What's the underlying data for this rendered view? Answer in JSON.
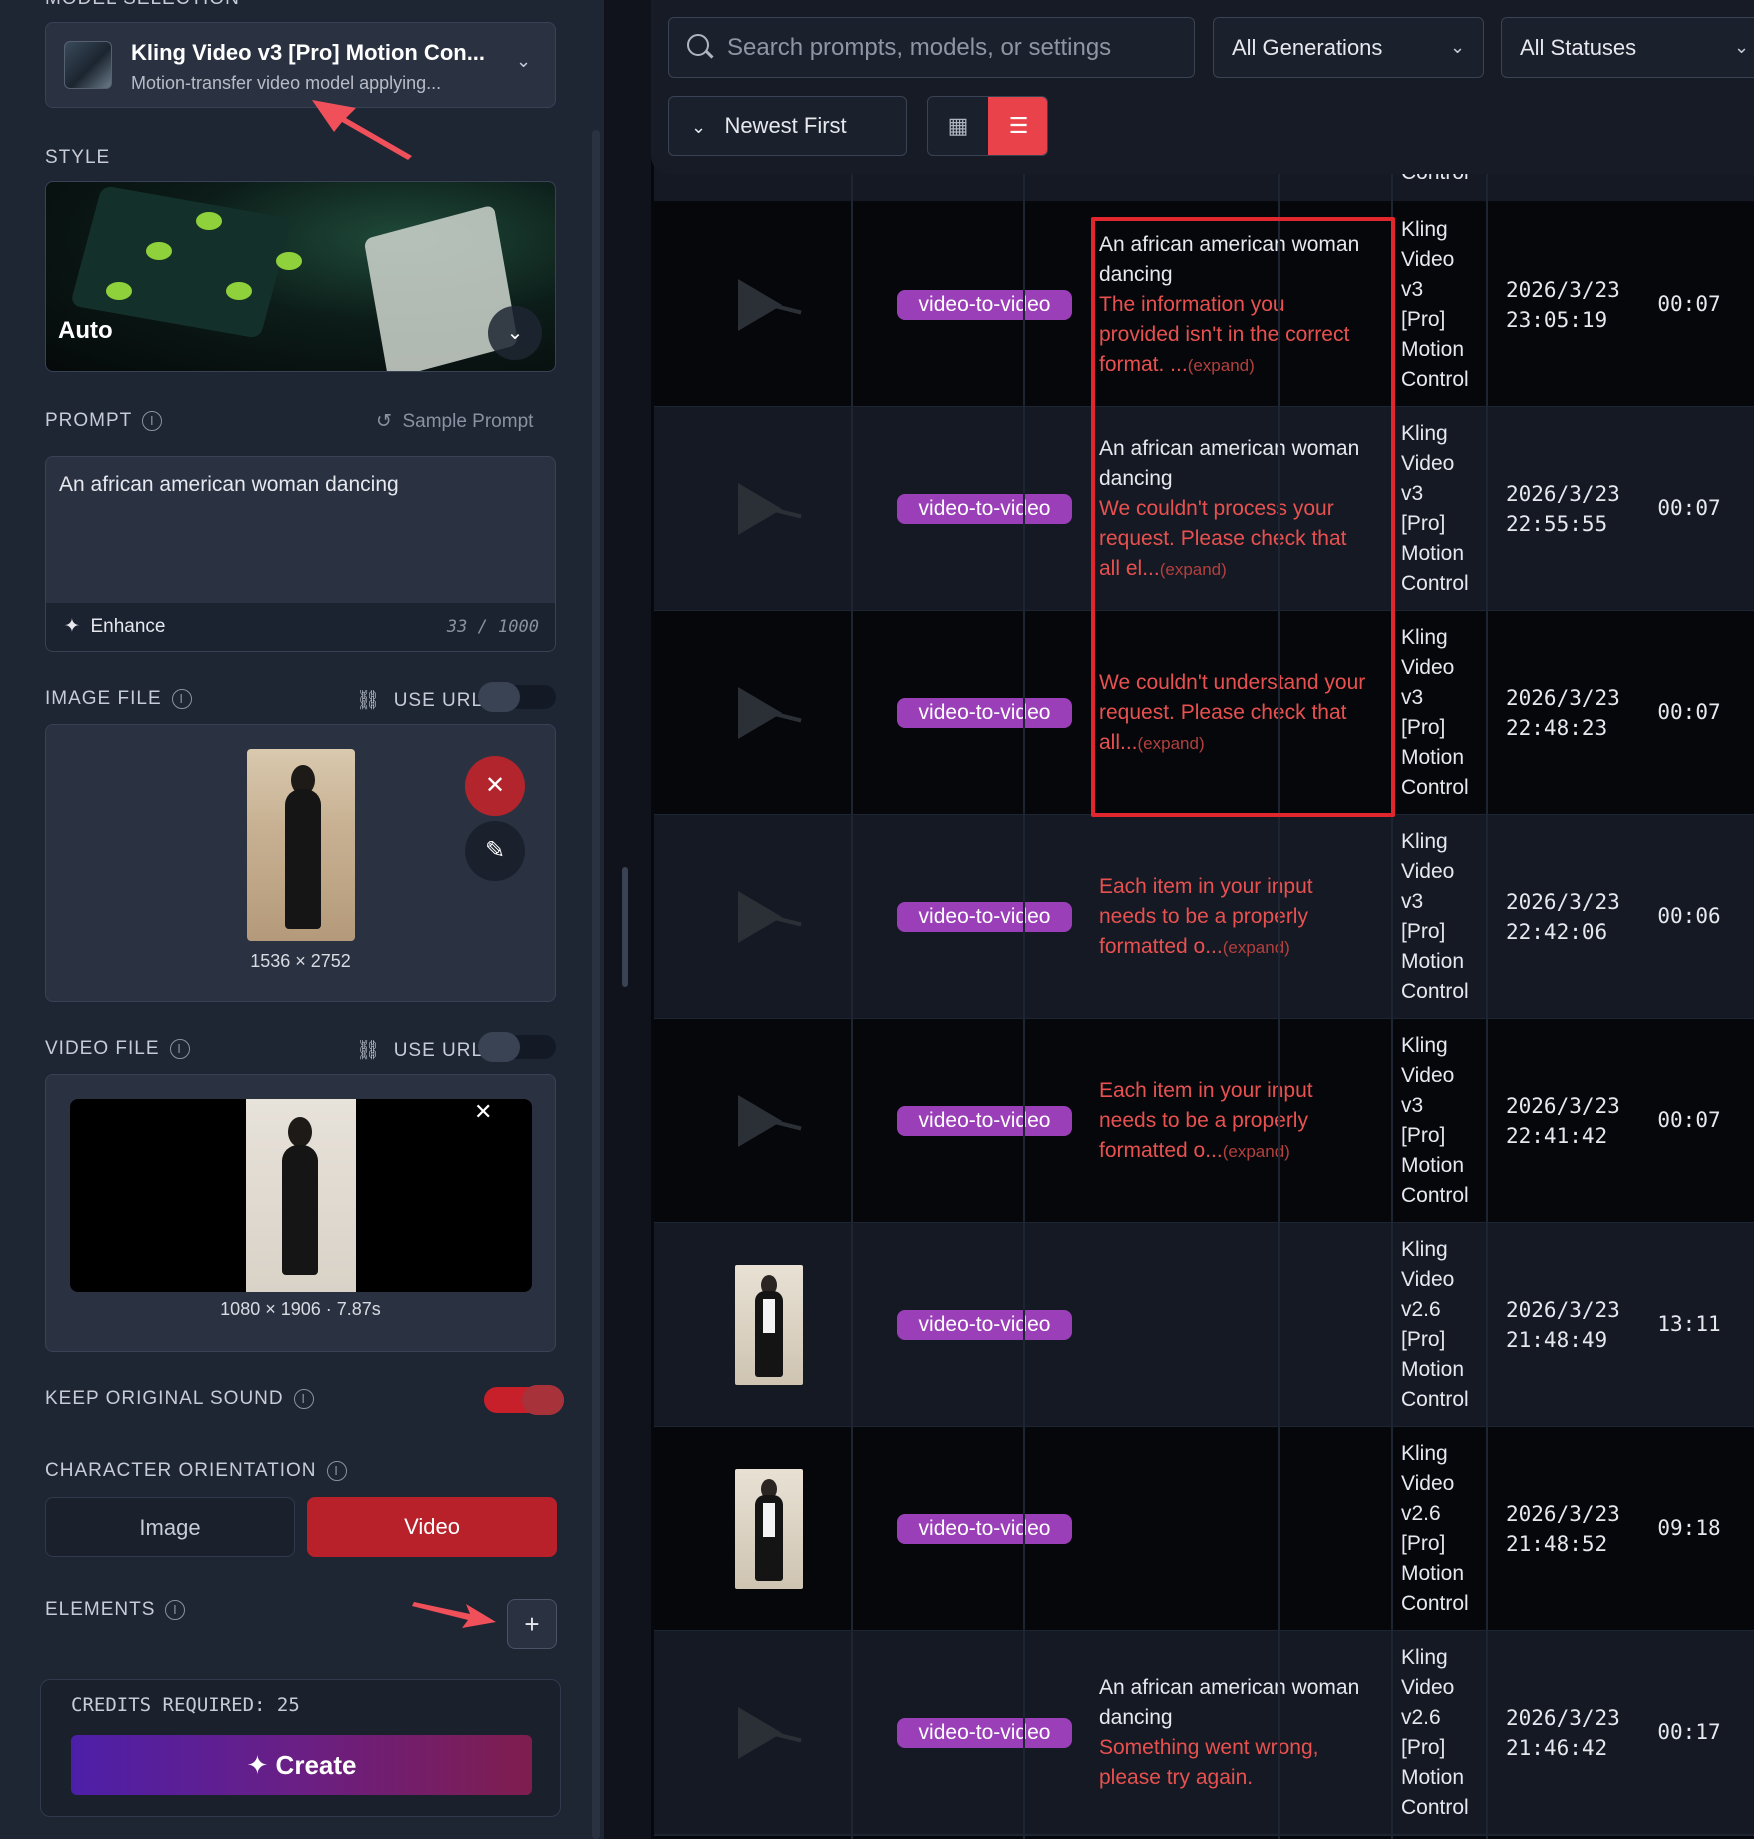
{
  "left": {
    "model_section_label": "MODEL SELECTION",
    "model": {
      "name": "Kling Video v3 [Pro] Motion Con...",
      "description": "Motion-transfer video model applying..."
    },
    "style_label": "STYLE",
    "style_name": "Auto",
    "prompt_label": "PROMPT",
    "sample_prompt": "Sample Prompt",
    "prompt_value": "An african american woman dancing",
    "enhance_label": "Enhance",
    "char_count": "33",
    "char_max": "1000",
    "image_file_label": "IMAGE FILE",
    "use_url_label": "USE URL",
    "image_dims": "1536 × 2752",
    "video_file_label": "VIDEO FILE",
    "video_info": "1080 × 1906 · 7.87s",
    "keep_sound_label": "KEEP ORIGINAL SOUND",
    "keep_sound_on": true,
    "orientation_label": "CHARACTER ORIENTATION",
    "orientation_options": [
      "Image",
      "Video"
    ],
    "orientation_selected": "Video",
    "elements_label": "ELEMENTS",
    "credits_label": "CREDITS REQUIRED: 25",
    "create_label": "Create"
  },
  "toolbar": {
    "search_placeholder": "Search prompts, models, or settings",
    "generations_filter": "All Generations",
    "status_filter": "All Statuses",
    "sort_label": "Newest First",
    "view_mode": "list"
  },
  "table": {
    "partial_top_model": "Control",
    "rows": [
      {
        "thumb": "play",
        "type": "video-to-video",
        "prompt": "An african american woman dancing",
        "error": "The information you provided isn't in the correct format. ...",
        "expand": "(expand)",
        "model": [
          "Kling",
          "Video",
          "v3",
          "[Pro]",
          "Motion",
          "Control"
        ],
        "date": "2026/3/23",
        "time": "23:05:19",
        "duration": "00:07"
      },
      {
        "thumb": "play",
        "type": "video-to-video",
        "prompt": "An african american woman dancing",
        "error": "We couldn't process your request. Please check that all el...",
        "expand": "(expand)",
        "model": [
          "Kling",
          "Video",
          "v3",
          "[Pro]",
          "Motion",
          "Control"
        ],
        "date": "2026/3/23",
        "time": "22:55:55",
        "duration": "00:07"
      },
      {
        "thumb": "play",
        "type": "video-to-video",
        "prompt": "",
        "error": "We couldn't understand your request. Please check that all...",
        "expand": "(expand)",
        "model": [
          "Kling",
          "Video",
          "v3",
          "[Pro]",
          "Motion",
          "Control"
        ],
        "date": "2026/3/23",
        "time": "22:48:23",
        "duration": "00:07"
      },
      {
        "thumb": "play",
        "type": "video-to-video",
        "prompt": "",
        "error": "Each item in your input needs to be a properly formatted o...",
        "expand": "(expand)",
        "model": [
          "Kling",
          "Video",
          "v3",
          "[Pro]",
          "Motion",
          "Control"
        ],
        "date": "2026/3/23",
        "time": "22:42:06",
        "duration": "00:06"
      },
      {
        "thumb": "play",
        "type": "video-to-video",
        "prompt": "",
        "error": "Each item in your input needs to be a properly formatted o...",
        "expand": "(expand)",
        "model": [
          "Kling",
          "Video",
          "v3",
          "[Pro]",
          "Motion",
          "Control"
        ],
        "date": "2026/3/23",
        "time": "22:41:42",
        "duration": "00:07"
      },
      {
        "thumb": "image",
        "type": "video-to-video",
        "prompt": "",
        "error": "",
        "expand": "",
        "model": [
          "Kling",
          "Video",
          "v2.6",
          "[Pro]",
          "Motion",
          "Control"
        ],
        "date": "2026/3/23",
        "time": "21:48:49",
        "duration": "13:11"
      },
      {
        "thumb": "image",
        "type": "video-to-video",
        "prompt": "",
        "error": "",
        "expand": "",
        "model": [
          "Kling",
          "Video",
          "v2.6",
          "[Pro]",
          "Motion",
          "Control"
        ],
        "date": "2026/3/23",
        "time": "21:48:52",
        "duration": "09:18"
      },
      {
        "thumb": "play",
        "type": "video-to-video",
        "prompt": "An african american woman dancing",
        "error": "Something went wrong, please try again.",
        "expand": "",
        "model": [
          "Kling",
          "Video",
          "v2.6",
          "[Pro]",
          "Motion",
          "Control"
        ],
        "date": "2026/3/23",
        "time": "21:46:42",
        "duration": "00:17"
      }
    ]
  },
  "colors": {
    "accent_red": "#e9424a",
    "badge_purple": "#9b3fb8",
    "error_red": "#e8514f",
    "create_gradient_start": "#4d1fa8",
    "create_gradient_end": "#7f1d4e"
  }
}
